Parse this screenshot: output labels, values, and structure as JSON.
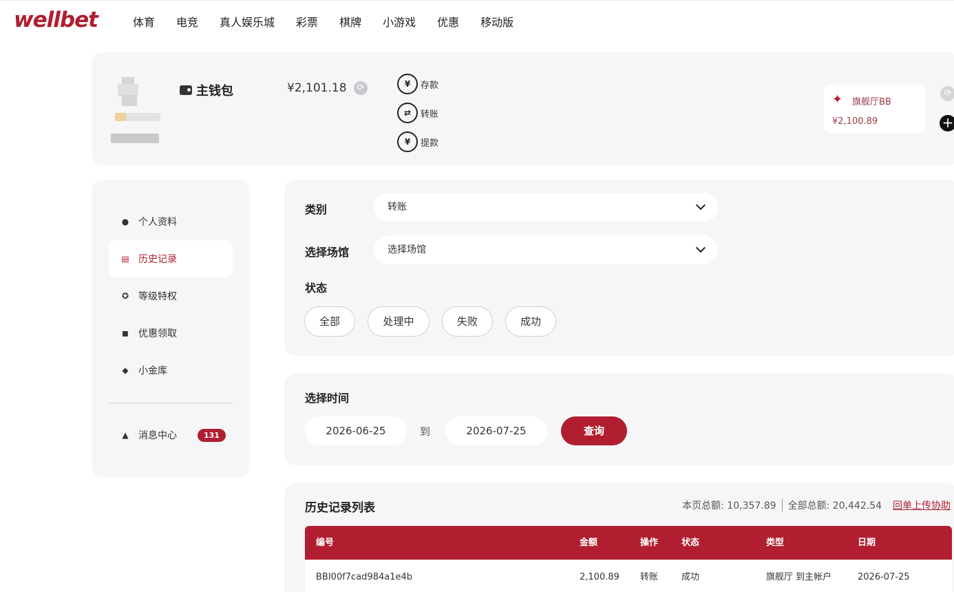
{
  "brand": {
    "logo_text": "wellbet",
    "accent_color": "#b01e30"
  },
  "nav": {
    "items": [
      "体育",
      "电竞",
      "真人娱乐城",
      "彩票",
      "棋牌",
      "小游戏",
      "优惠",
      "移动版"
    ]
  },
  "wallet": {
    "title": "主钱包",
    "balance": "¥2,101.18",
    "actions": [
      {
        "label": "存款",
        "icon": "deposit-icon"
      },
      {
        "label": "转账",
        "icon": "transfer-icon"
      },
      {
        "label": "提款",
        "icon": "withdraw-icon"
      }
    ],
    "venue": {
      "name": "旗舰厅BB",
      "balance": "¥2,100.89",
      "icon": "eagle-logo-icon"
    }
  },
  "sidebar": {
    "items": [
      {
        "label": "个人资料",
        "icon": "user-icon"
      },
      {
        "label": "历史记录",
        "icon": "document-icon",
        "active": true
      },
      {
        "label": "等级特权",
        "icon": "medal-icon"
      },
      {
        "label": "优惠领取",
        "icon": "gift-icon"
      },
      {
        "label": "小金库",
        "icon": "diamond-icon"
      }
    ],
    "message_center": {
      "label": "消息中心",
      "icon": "bell-icon",
      "badge": "131"
    }
  },
  "filters": {
    "category_label": "类别",
    "category_value": "转账",
    "venue_label": "选择场馆",
    "venue_placeholder": "选择场馆",
    "status_label": "状态",
    "status_options": [
      "全部",
      "处理中",
      "失败",
      "成功"
    ]
  },
  "date_range": {
    "label": "选择时间",
    "start": "2026-06-25",
    "to_label": "到",
    "end": "2026-07-25",
    "query_label": "查询"
  },
  "history": {
    "title": "历史记录列表",
    "page_total": "本页总额: 10,357.89",
    "all_total": "全部总额: 20,442.54",
    "help_link": "回单上传协助",
    "columns": [
      "编号",
      "金额",
      "操作",
      "状态",
      "类型",
      "日期"
    ],
    "rows": [
      [
        "BBI00f7cad984a1e4b",
        "2,100.89",
        "转账",
        "成功",
        "旗舰厅 到主帐户",
        "2026-07-25"
      ]
    ]
  }
}
